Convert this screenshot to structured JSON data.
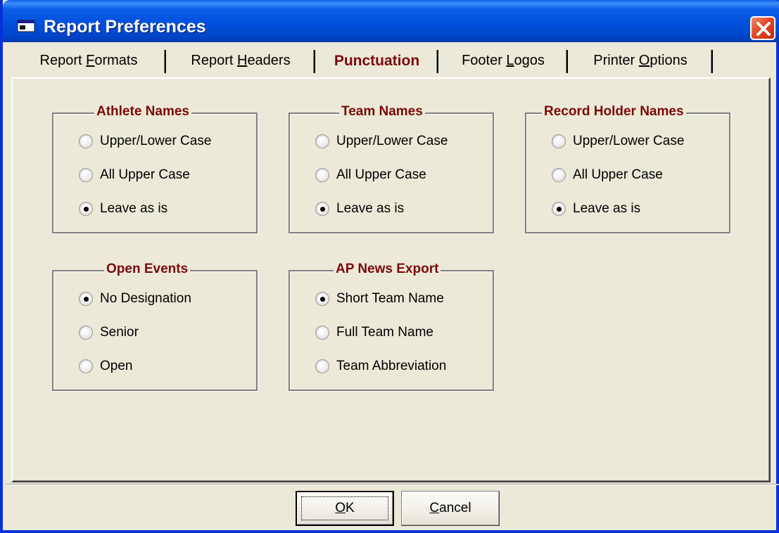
{
  "window": {
    "title": "Report Preferences"
  },
  "tabs": [
    {
      "label_pre": "Report ",
      "label_key": "F",
      "label_post": "ormats",
      "active": false
    },
    {
      "label_pre": "Report ",
      "label_key": "H",
      "label_post": "eaders",
      "active": false
    },
    {
      "label_pre": "",
      "label_key": "P",
      "label_post": "unctuation",
      "active": true
    },
    {
      "label_pre": "Footer ",
      "label_key": "L",
      "label_post": "ogos",
      "active": false
    },
    {
      "label_pre": "Printer ",
      "label_key": "O",
      "label_post": "ptions",
      "active": false
    }
  ],
  "groups": {
    "athlete": {
      "title": "Athlete Names",
      "options": [
        "Upper/Lower Case",
        "All Upper Case",
        "Leave as is"
      ],
      "selected": "Leave as is"
    },
    "team": {
      "title": "Team Names",
      "options": [
        "Upper/Lower Case",
        "All Upper Case",
        "Leave as is"
      ],
      "selected": "Leave as is"
    },
    "record": {
      "title": "Record Holder Names",
      "options": [
        "Upper/Lower Case",
        "All Upper Case",
        "Leave as is"
      ],
      "selected": "Leave as is"
    },
    "open": {
      "title": "Open Events",
      "options": [
        "No Designation",
        "Senior",
        "Open"
      ],
      "selected": "No Designation"
    },
    "apnews": {
      "title": "AP News Export",
      "options": [
        "Short Team Name",
        "Full Team Name",
        "Team Abbreviation"
      ],
      "selected": "Short Team Name"
    }
  },
  "buttons": {
    "ok": {
      "label_key": "O",
      "label_post": "K"
    },
    "cancel": {
      "label_key": "C",
      "label_post": "ancel"
    }
  },
  "colors": {
    "accent_text": "#7a0a0a",
    "titlebar": "#0250de",
    "background": "#ece9d8"
  }
}
